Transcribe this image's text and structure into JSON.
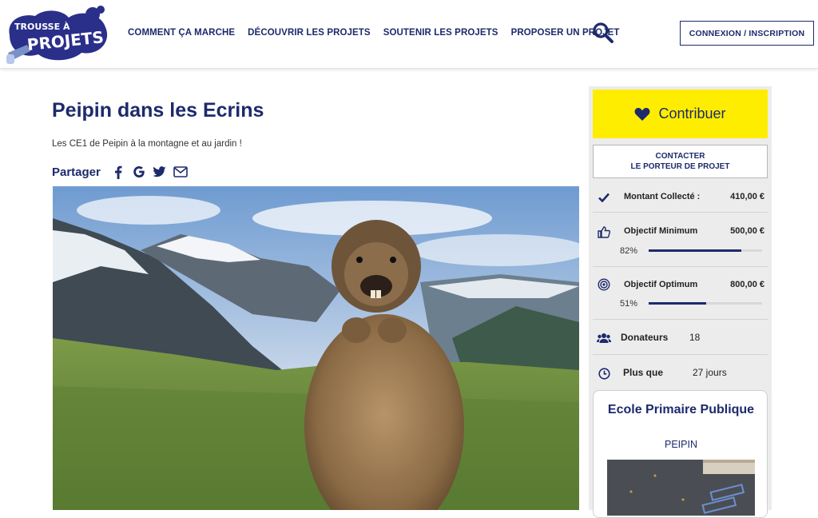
{
  "header": {
    "logo_text_top": "TROUSSE À",
    "logo_text_bottom": "PROJETS",
    "nav": [
      "COMMENT ÇA MARCHE",
      "DÉCOUVRIR LES PROJETS",
      "SOUTENIR LES PROJETS",
      "PROPOSER UN PROJET"
    ],
    "search_icon": "search-icon",
    "login_label": "CONNEXION / INSCRIPTION"
  },
  "project": {
    "title": "Peipin dans les Ecrins",
    "subtitle": "Les CE1 de Peipin à la montagne et au jardin !",
    "share_label": "Partager",
    "share_icons": [
      "facebook-icon",
      "google-icon",
      "twitter-icon",
      "mail-icon"
    ],
    "image": "marmot-photo"
  },
  "sidebar": {
    "contribute_label": "Contribuer",
    "contact_line1": "CONTACTER",
    "contact_line2": "LE PORTEUR DE PROJET",
    "collected_label": "Montant Collecté :",
    "collected_value": "410,00 €",
    "min_label": "Objectif Minimum",
    "min_value": "500,00 €",
    "min_pct": "82%",
    "min_progress": 0.82,
    "opt_label": "Objectif Optimum",
    "opt_value": "800,00 €",
    "opt_pct": "51%",
    "opt_progress": 0.51,
    "donors_label": "Donateurs",
    "donors_value": "18",
    "time_label": "Plus que",
    "time_value": "27 jours"
  },
  "owner": {
    "name": "Ecole Primaire Publique",
    "city": "PEIPIN"
  },
  "colors": {
    "brand_navy": "#1d2a6b",
    "button_yellow": "#ffed00",
    "sidebar_gray": "#ececec"
  }
}
